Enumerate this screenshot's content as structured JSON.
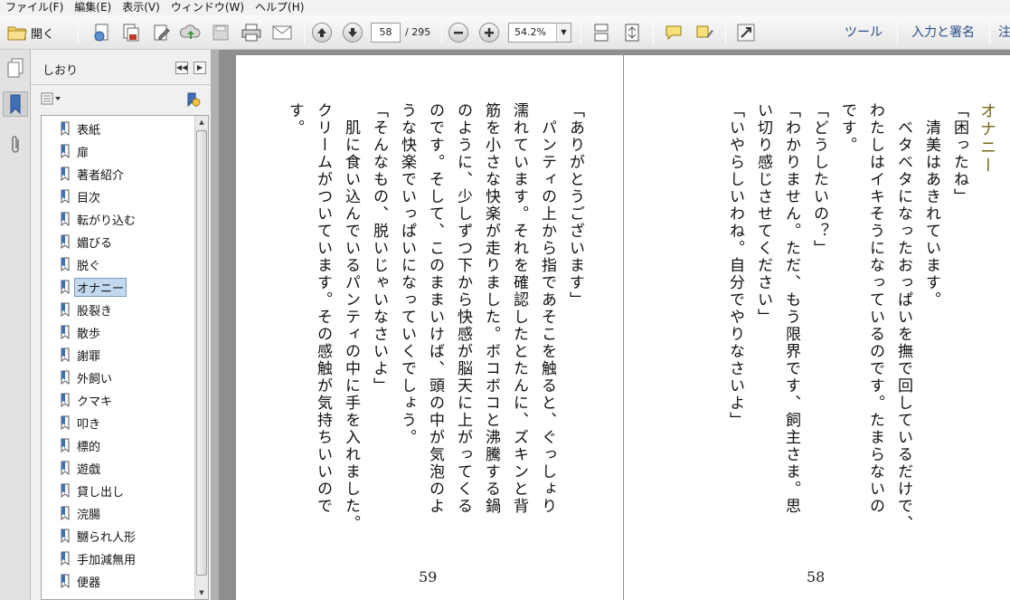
{
  "menu": [
    "ファイル(F)",
    "編集(E)",
    "表示(V)",
    "ウィンドウ(W)",
    "ヘルプ(H)"
  ],
  "toolbar": {
    "open_label": "開く",
    "current_page": "58",
    "total_pages": "/ 295",
    "zoom": "54.2%",
    "tools_label": "ツール",
    "sign_label": "入力と署名",
    "comment_label": "注"
  },
  "panel": {
    "title": "しおり",
    "bookmarks": [
      "表紙",
      "扉",
      "著者紹介",
      "目次",
      "転がり込む",
      "媚びる",
      "脱ぐ",
      "オナニー",
      "股裂き",
      "散歩",
      "謝罪",
      "外飼い",
      "クマキ",
      "叩き",
      "標的",
      "遊戯",
      "貸し出し",
      "浣腸",
      "嬲られ人形",
      "手加減無用",
      "便器"
    ],
    "selected_index": 7
  },
  "pages": {
    "right": {
      "number": "58",
      "title": "オナニー",
      "lines": [
        "「困ったね」",
        "　清美はあきれています。",
        "　ベタベタになったおっぱいを撫で回しているだけで、",
        "わたしはイキそうになっているのです。たまらないの",
        "です。",
        "「どうしたいの？」",
        "「わかりません。ただ、もう限界です、飼主さま。思",
        "い切り感じさせてください」",
        "「いやらしいわね。自分でやりなさいよ」"
      ]
    },
    "left": {
      "number": "59",
      "lines": [
        "「ありがとうございます」",
        "　パンティの上から指であそこを触ると、ぐっしょり",
        "濡れています。それを確認したとたんに、ズキンと背",
        "筋を小さな快楽が走りました。ボコボコと沸騰する鍋",
        "のように、少しずつ下から快感が脳天に上がってくる",
        "のです。そして、このままいけば、頭の中が気泡のよ",
        "うな快楽でいっぱいになっていくでしょう。",
        "「そんなもの、脱いじゃいなさいよ」",
        "　肌に食い込んでいるパンティの中に手を入れました。",
        "クリームがついています。その感触が気持ちいいので",
        "す。"
      ]
    }
  },
  "colors": {
    "title_gold": "#7a6a1a",
    "link_blue": "#2a4f86",
    "selection": "#c3d9ee"
  }
}
